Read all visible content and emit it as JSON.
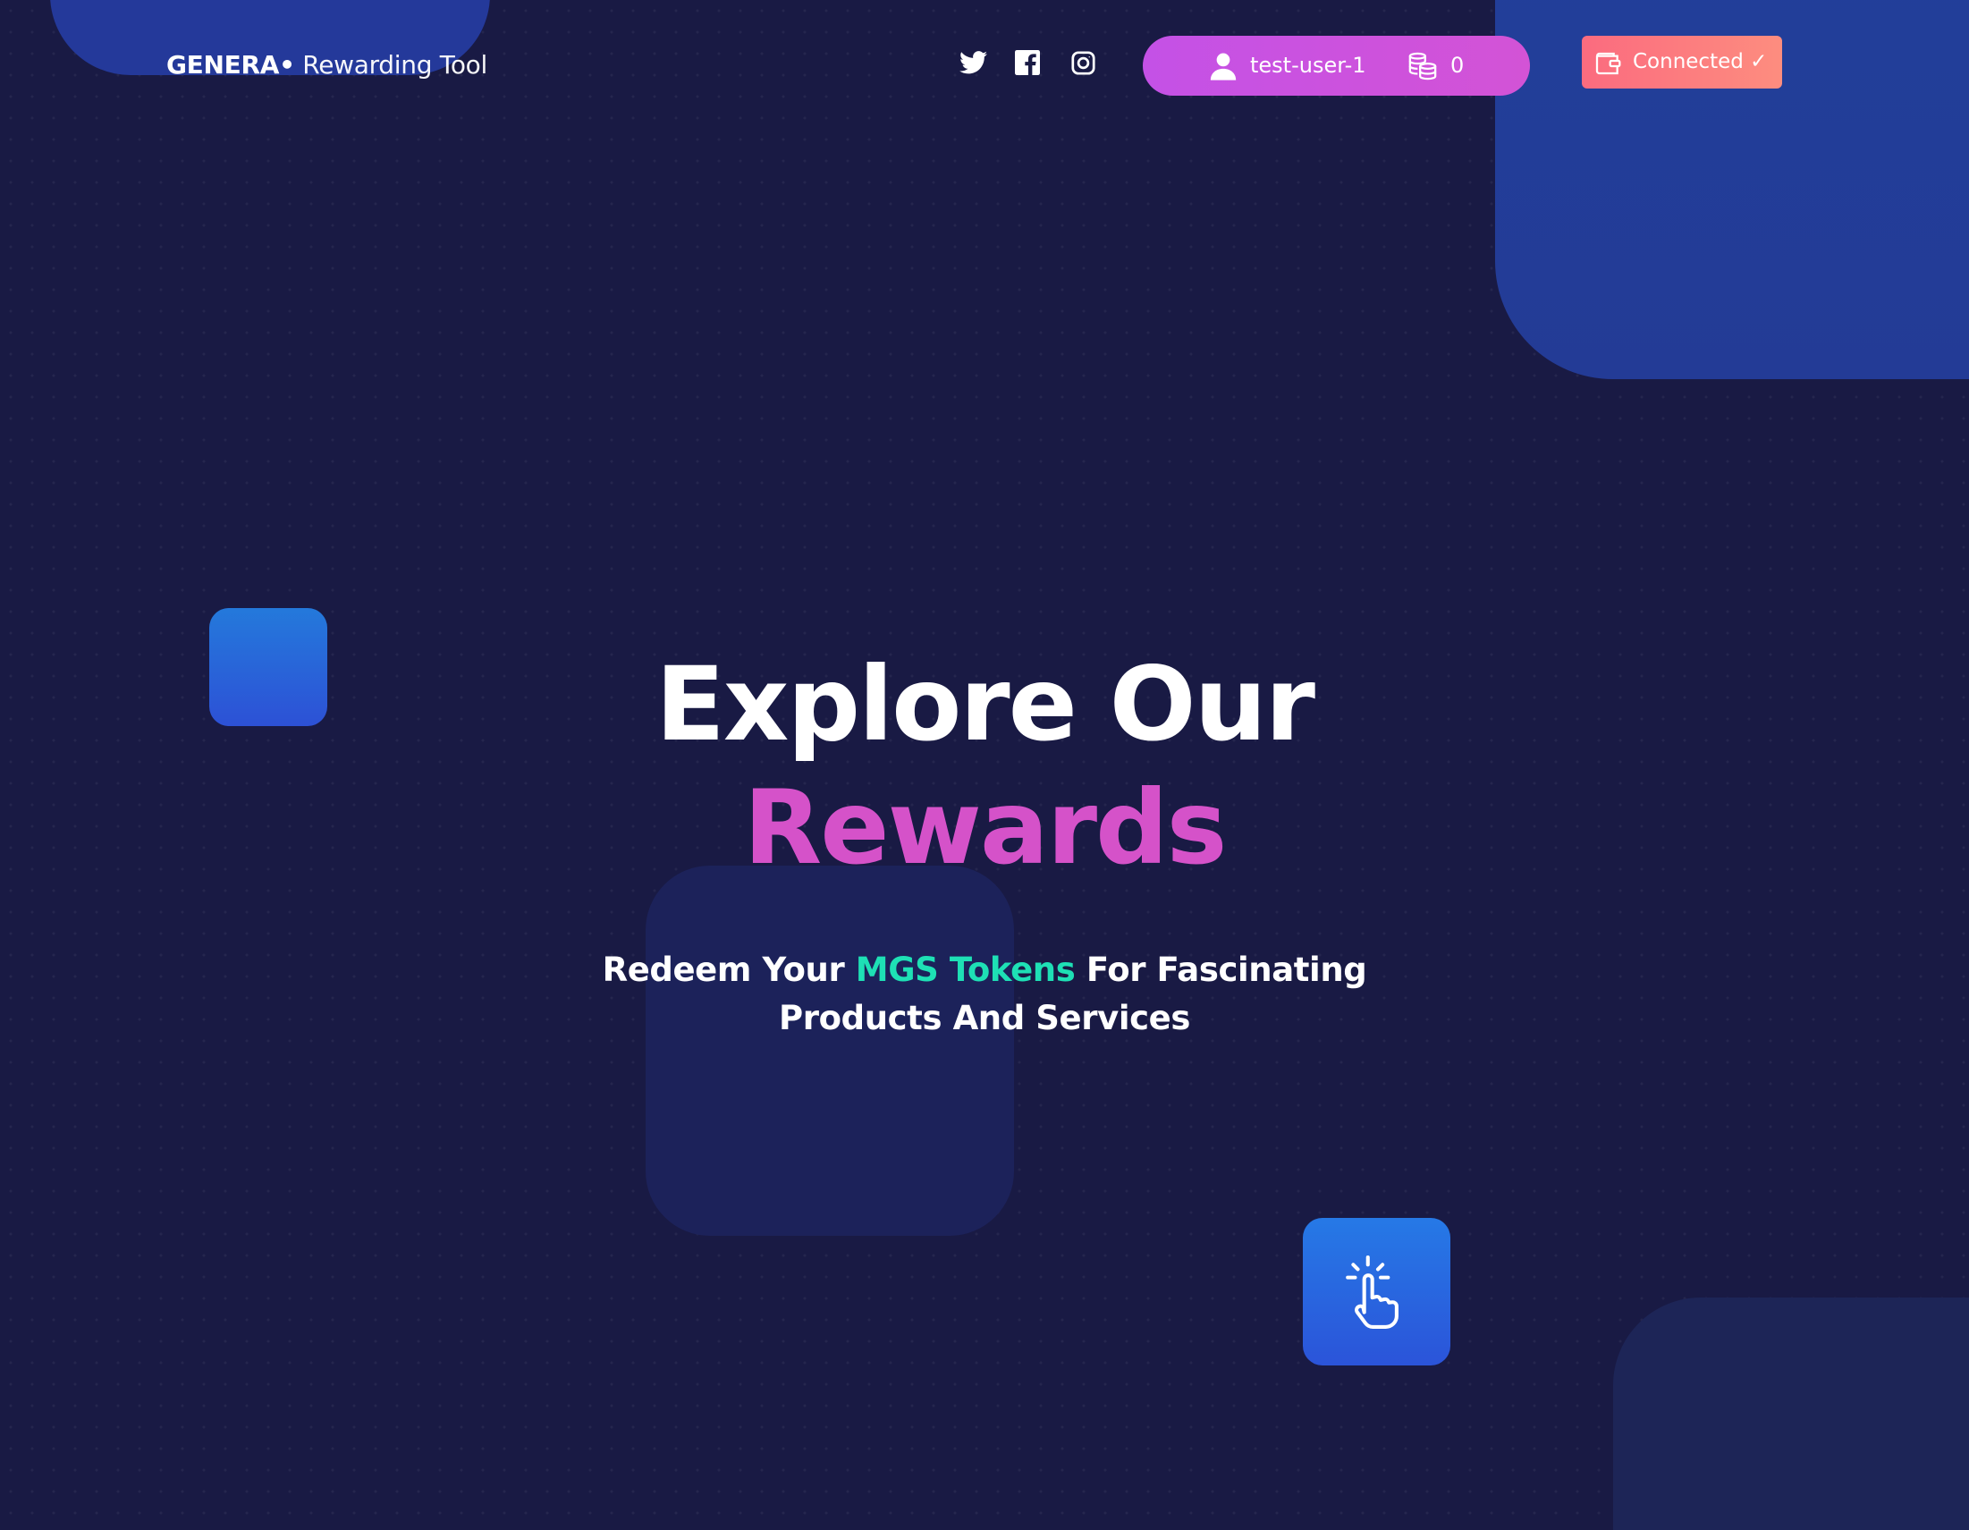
{
  "header": {
    "brand_strong": "GENERA•",
    "brand_light": " Rewarding Tool",
    "social": [
      {
        "name": "twitter-icon"
      },
      {
        "name": "facebook-icon"
      },
      {
        "name": "instagram-icon"
      }
    ],
    "user": {
      "username": "test-user-1",
      "token_count": "0",
      "user_icon": "user-icon",
      "tokens_icon": "coins-icon"
    },
    "wallet": {
      "label": "Connected ✓",
      "icon": "wallet-icon"
    }
  },
  "hero": {
    "title_line1": "Explore Our",
    "title_line2": "Rewards",
    "subtitle_prefix": "Redeem Your ",
    "subtitle_accent": "MGS Tokens",
    "subtitle_mid": " For Fascinating",
    "subtitle_line2": "Products And Services",
    "action_icon": "tap-pointer-icon"
  },
  "colors": {
    "background": "#191a44",
    "accent_pink": "#d552c9",
    "accent_teal": "#1ee0b5",
    "pill_gradient": [
      "#c451e6",
      "#d353d6"
    ],
    "connected_gradient": [
      "#fb6b7f",
      "#fd8d7f"
    ],
    "button_blue": "#2679e6"
  }
}
